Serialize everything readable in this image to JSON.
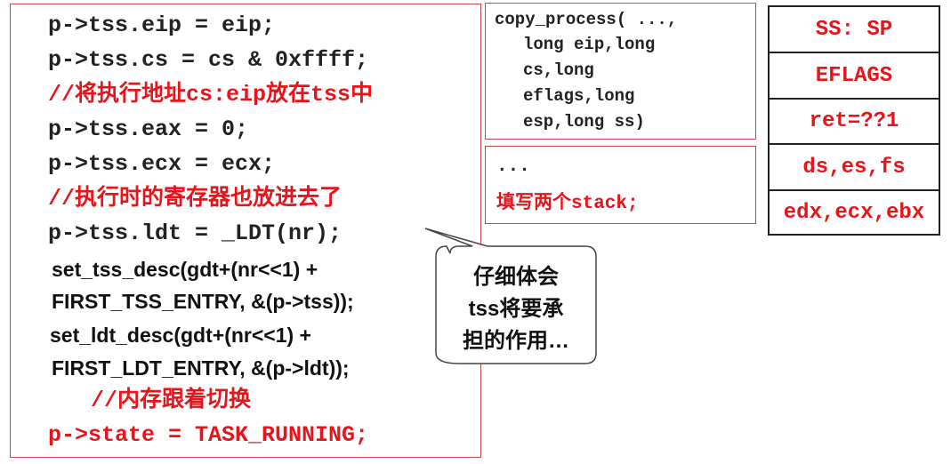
{
  "code": {
    "lines": [
      "p->tss.eip = eip;",
      "p->tss.cs = cs & 0xffff;",
      "//将执行地址cs:eip放在tss中",
      "p->tss.eax = 0;",
      "p->tss.ecx = ecx;",
      "//执行时的寄存器也放进去了",
      "p->tss.ldt = _LDT(nr);",
      "set_tss_desc(gdt+(nr<<1) +",
      "FIRST_TSS_ENTRY, &(p->tss));",
      "set_ldt_desc(gdt+(nr<<1) +",
      "FIRST_LDT_ENTRY, &(p->ldt));",
      "//内存跟着切换",
      "p->state = TASK_RUNNING;"
    ]
  },
  "copy_process": {
    "lines": [
      "copy_process( ...,",
      "long eip,long",
      "cs,long",
      "eflags,long",
      "esp,long ss)"
    ]
  },
  "fill": {
    "lines": [
      "...",
      "填写两个stack;"
    ]
  },
  "stack": {
    "cells": [
      "SS: SP",
      "EFLAGS",
      "ret=??1",
      "ds,es,fs",
      "edx,ecx,ebx"
    ]
  },
  "callout": {
    "lines": [
      "仔细体会",
      "tss将要承",
      "担的作用…"
    ]
  },
  "colors": {
    "comment_red": "#e8141b",
    "box_border": "#c0504d",
    "text_dark": "#222222"
  }
}
